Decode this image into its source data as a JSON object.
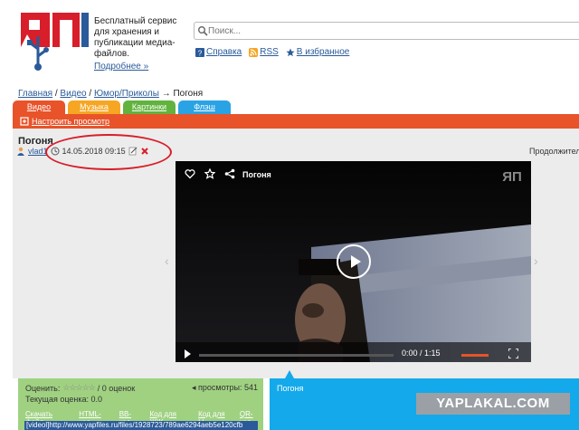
{
  "header": {
    "tagline": "Бесплатный сервис для хранения и публикации медиа-файлов.",
    "more_link": "Подробнее »",
    "search_placeholder": "Поиск...",
    "links": {
      "help": "Справка",
      "rss": "RSS",
      "favorites": "В избранное"
    }
  },
  "breadcrumb": {
    "home": "Главная",
    "video": "Видео",
    "humor": "Юмор/Приколы",
    "current": "→ Погоня"
  },
  "tabs": {
    "video": "Видео",
    "music": "Музыка",
    "pictures": "Картинки",
    "flash": "Флэш"
  },
  "settings_label": "Настроить просмотр",
  "item": {
    "title": "Погоня",
    "user": "vlad1",
    "datetime": "14.05.2018 09:15",
    "duration_label": "Продолжитель"
  },
  "player": {
    "title": "Погоня",
    "current_time": "0:00",
    "separator": " / ",
    "total_time": "1:15",
    "logo_text": "ЯП"
  },
  "rating": {
    "label": "Оценить:",
    "stars": "☆☆☆☆☆",
    "votes": "/ 0 оценок",
    "views": "просмотры: 541",
    "current": "Текущая оценка: 0.0",
    "links": [
      "Скачать файл",
      "HTML-код",
      "BB-код",
      "Код для ЖЖ",
      "Код для LI",
      "QR-код"
    ],
    "code": "[videol]http://www.yapfiles.ru/files/1928723/789ae6294aeb5e120cfb"
  },
  "blue_panel": {
    "title": "Погоня"
  },
  "watermark": "YAPLAKAL.COM",
  "colors": {
    "video_tab": "#e8532a",
    "music_tab": "#f6a623",
    "pictures_tab": "#61b33e",
    "flash_tab": "#2aa3e4",
    "rating_panel": "#9fd181",
    "blue_panel": "#14a9ea",
    "annotation": "#d81e2a"
  }
}
